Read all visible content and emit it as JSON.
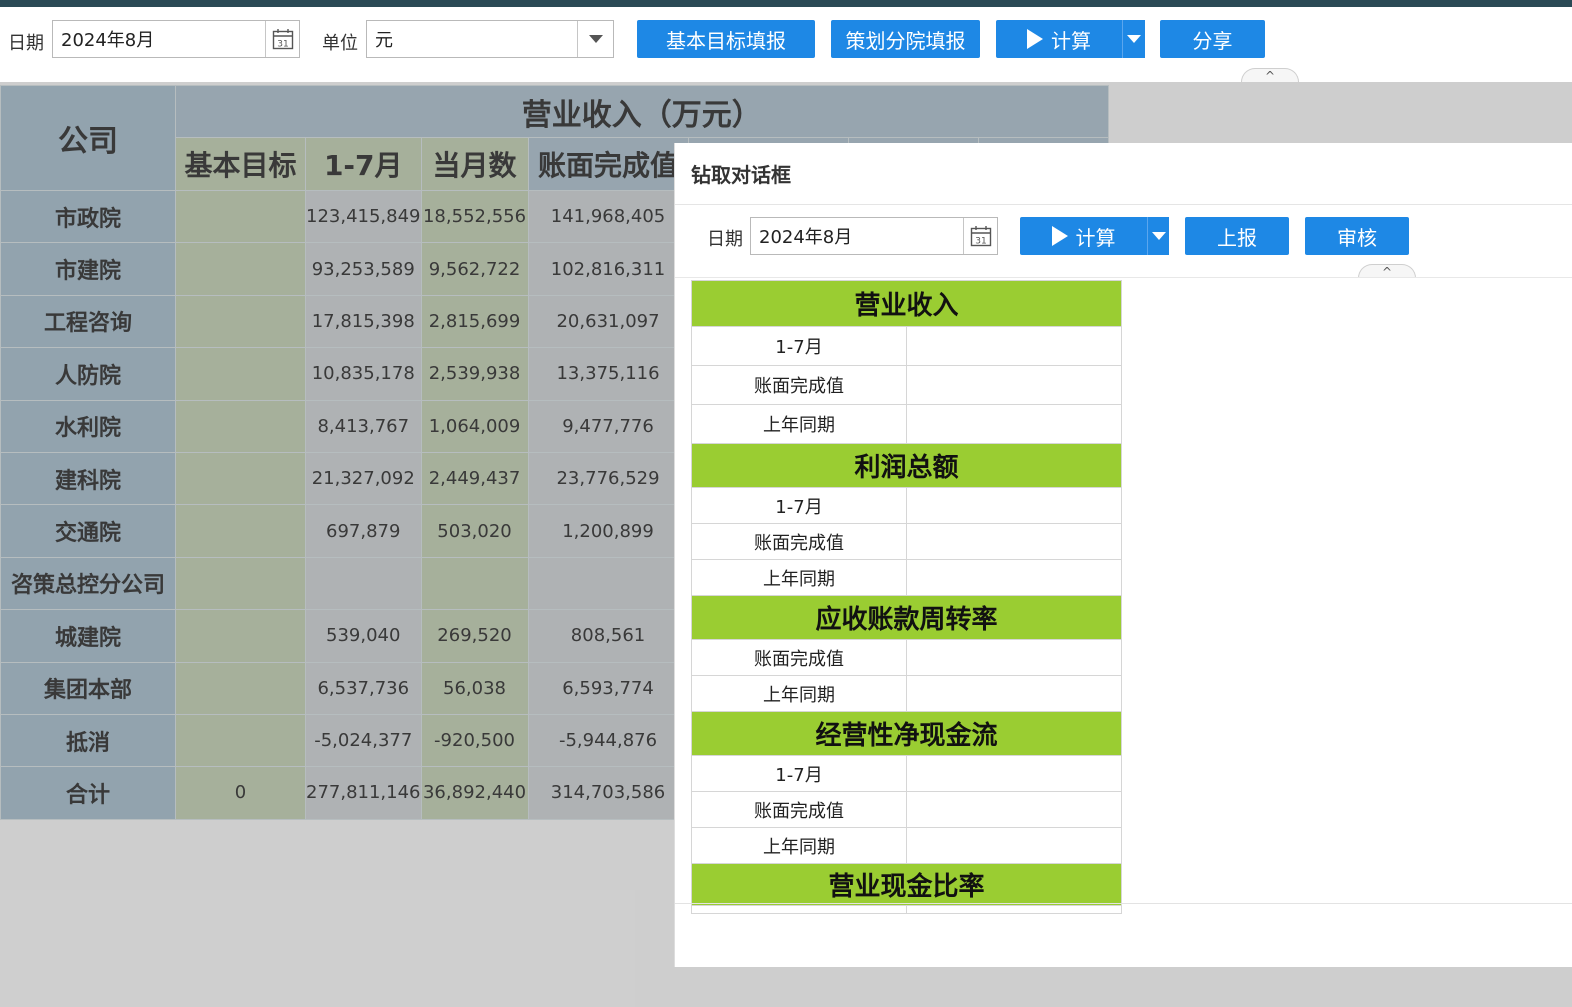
{
  "toolbar": {
    "date_label": "日期",
    "date_value": "2024年8月",
    "unit_label": "单位",
    "unit_value": "元",
    "btn_basic_target": "基本目标填报",
    "btn_plan_branch": "策划分院填报",
    "btn_calc": "计算",
    "btn_share": "分享"
  },
  "table": {
    "company_header": "公司",
    "group_header": "营业收入（万元）",
    "columns": [
      "基本目标",
      "1-7月",
      "当月数",
      "账面完成值"
    ],
    "rows": [
      {
        "company": "市政院",
        "target": "",
        "ytd": "123,415,849",
        "month": "18,552,556",
        "book": "141,968,405"
      },
      {
        "company": "市建院",
        "target": "",
        "ytd": "93,253,589",
        "month": "9,562,722",
        "book": "102,816,311"
      },
      {
        "company": "工程咨询",
        "target": "",
        "ytd": "17,815,398",
        "month": "2,815,699",
        "book": "20,631,097"
      },
      {
        "company": "人防院",
        "target": "",
        "ytd": "10,835,178",
        "month": "2,539,938",
        "book": "13,375,116"
      },
      {
        "company": "水利院",
        "target": "",
        "ytd": "8,413,767",
        "month": "1,064,009",
        "book": "9,477,776"
      },
      {
        "company": "建科院",
        "target": "",
        "ytd": "21,327,092",
        "month": "2,449,437",
        "book": "23,776,529"
      },
      {
        "company": "交通院",
        "target": "",
        "ytd": "697,879",
        "month": "503,020",
        "book": "1,200,899"
      },
      {
        "company": "咨策总控分公司",
        "target": "",
        "ytd": "",
        "month": "",
        "book": ""
      },
      {
        "company": "城建院",
        "target": "",
        "ytd": "539,040",
        "month": "269,520",
        "book": "808,561"
      },
      {
        "company": "集团本部",
        "target": "",
        "ytd": "6,537,736",
        "month": "56,038",
        "book": "6,593,774"
      },
      {
        "company": "抵消",
        "target": "",
        "ytd": "-5,024,377",
        "month": "-920,500",
        "book": "-5,944,876"
      },
      {
        "company": "合计",
        "target": "0",
        "ytd": "277,811,146",
        "month": "36,892,440",
        "book": "314,703,586"
      }
    ]
  },
  "dialog": {
    "title": "钻取对话框",
    "date_label": "日期",
    "date_value": "2024年8月",
    "btn_calc": "计算",
    "btn_report": "上报",
    "btn_review": "审核",
    "sections": [
      {
        "title": "营业收入",
        "rows": [
          "1-7月",
          "账面完成值",
          "上年同期"
        ]
      },
      {
        "title": "利润总额",
        "rows": [
          "1-7月",
          "账面完成值",
          "上年同期"
        ]
      },
      {
        "title": "应收账款周转率",
        "rows": [
          "账面完成值",
          "上年同期"
        ]
      },
      {
        "title": "经营性净现金流",
        "rows": [
          "1-7月",
          "账面完成值",
          "上年同期"
        ]
      },
      {
        "title": "营业现金比率",
        "rows": []
      }
    ]
  },
  "icons": {
    "calendar_day": "31",
    "collapse": "^"
  },
  "colors": {
    "button_blue": "#1e88e5",
    "section_green": "#9acd32",
    "header_steel": "#a4b8c5"
  }
}
